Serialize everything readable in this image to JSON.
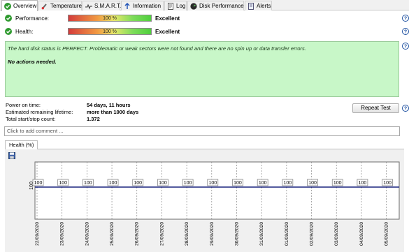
{
  "tabs": [
    {
      "label": "Overview",
      "icon": "check-circle-icon",
      "active": true
    },
    {
      "label": "Temperature",
      "icon": "thermometer-icon",
      "active": false
    },
    {
      "label": "S.M.A.R.T.",
      "icon": "smart-icon",
      "active": false
    },
    {
      "label": "Information",
      "icon": "info-icon",
      "active": false
    },
    {
      "label": "Log",
      "icon": "log-icon",
      "active": false
    },
    {
      "label": "Disk Performance",
      "icon": "performance-icon",
      "active": false
    },
    {
      "label": "Alerts",
      "icon": "alerts-icon",
      "active": false
    }
  ],
  "performance": {
    "label": "Performance:",
    "percent_text": "100 %",
    "percent": 100,
    "rating": "Excellent"
  },
  "health": {
    "label": "Health:",
    "percent_text": "100 %",
    "percent": 100,
    "rating": "Excellent"
  },
  "status": {
    "message": "The hard disk status is PERFECT. Problematic or weak sectors were not found and there are no spin up or data transfer errors.",
    "actions": "No actions needed."
  },
  "info": {
    "power_on_label": "Power on time:",
    "power_on_value": "54 days, 11 hours",
    "remaining_label": "Estimated remaining lifetime:",
    "remaining_value": "more than 1000 days",
    "startstop_label": "Total start/stop count:",
    "startstop_value": "1.372"
  },
  "repeat_button": "Repeat Test",
  "comment_placeholder": "Click to add comment ...",
  "health_tab": "Health (%)",
  "colors": {
    "ok_green": "#2f9a2f",
    "status_bg": "#c8f7c8",
    "line": "#1a237e",
    "help": "#1c4fa0"
  },
  "chart_data": {
    "type": "line",
    "title": "Health (%)",
    "xlabel": "",
    "ylabel": "",
    "y_tick": "100",
    "x": [
      "22/09/2020",
      "23/09/2020",
      "24/09/2020",
      "25/09/2020",
      "26/09/2020",
      "27/09/2020",
      "28/09/2020",
      "29/09/2020",
      "30/09/2020",
      "31/09/2020",
      "01/09/2020",
      "02/09/2020",
      "03/09/2020",
      "04/09/2020",
      "05/09/2020"
    ],
    "series": [
      {
        "name": "",
        "values": [
          100,
          100,
          100,
          100,
          100,
          100,
          100,
          100,
          100,
          100,
          100,
          100,
          100,
          100,
          100
        ]
      }
    ],
    "data_labels": [
      "100",
      "100",
      "100",
      "100",
      "100",
      "100",
      "100",
      "100",
      "100",
      "100",
      "100",
      "100",
      "100",
      "100",
      "100"
    ],
    "grid": true
  }
}
